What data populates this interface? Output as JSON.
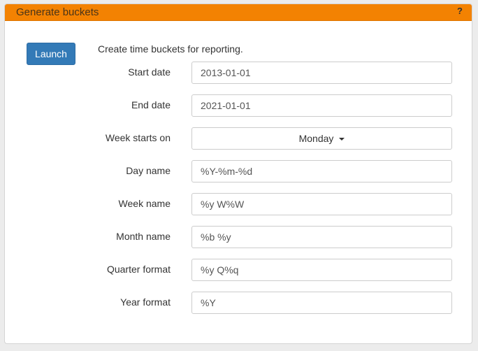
{
  "header": {
    "title": "Generate buckets",
    "help_label": "?"
  },
  "launch_label": "Launch",
  "description": "Create time buckets for reporting.",
  "fields": {
    "start_date": {
      "label": "Start date",
      "value": "2013-01-01"
    },
    "end_date": {
      "label": "End date",
      "value": "2021-01-01"
    },
    "week_start": {
      "label": "Week starts on",
      "value": "Monday"
    },
    "day_name": {
      "label": "Day name",
      "value": "%Y-%m-%d"
    },
    "week_name": {
      "label": "Week name",
      "value": "%y W%W"
    },
    "month_name": {
      "label": "Month name",
      "value": "%b %y"
    },
    "quarter_format": {
      "label": "Quarter format",
      "value": "%y Q%q"
    },
    "year_format": {
      "label": "Year format",
      "value": "%Y"
    }
  },
  "colors": {
    "header_bg": "#f38202",
    "button_bg": "#337ab7"
  }
}
